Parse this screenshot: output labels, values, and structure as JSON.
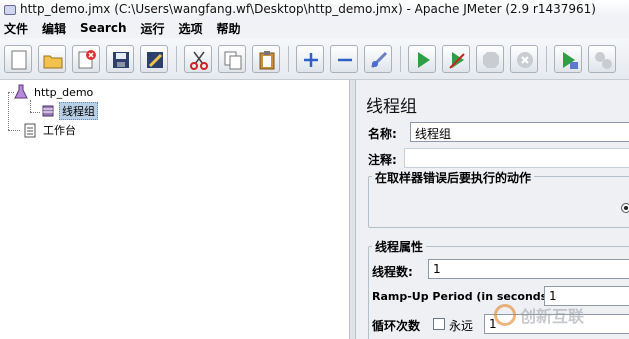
{
  "window": {
    "title": "http_demo.jmx (C:\\Users\\wangfang.wf\\Desktop\\http_demo.jmx) - Apache JMeter (2.9 r1437961)"
  },
  "menu": [
    "文件",
    "编辑",
    "Search",
    "运行",
    "选项",
    "帮助"
  ],
  "toolbar": {
    "buttons": [
      "new-icon",
      "open-icon",
      "close-icon",
      "save-icon",
      "save-as-icon",
      "cut-icon",
      "copy-icon",
      "paste-icon",
      "expand-icon",
      "collapse-icon",
      "toggle-icon",
      "start-icon",
      "start-no-timers-icon",
      "stop-icon",
      "shutdown-icon",
      "remote-start-icon",
      "remote-stop-icon"
    ]
  },
  "tree": {
    "root": "http_demo",
    "thread_group": "线程组",
    "workbench": "工作台"
  },
  "panel": {
    "title": "线程组",
    "name_label": "名称:",
    "name_value": "线程组",
    "comment_label": "注释:",
    "comment_value": "",
    "on_error_title": "在取样器错误后要执行的动作",
    "props_title": "线程属性",
    "threads_label": "线程数:",
    "threads_value": "1",
    "rampup_label": "Ramp-Up Period (in seconds):",
    "rampup_value": "1",
    "loop_label": "循环次数",
    "forever_label": "永远",
    "loop_value": "1"
  },
  "watermark": {
    "text": "创新互联"
  },
  "colors": {
    "selection": "#b8cfe5",
    "accent_orange": "#e07a1a"
  }
}
